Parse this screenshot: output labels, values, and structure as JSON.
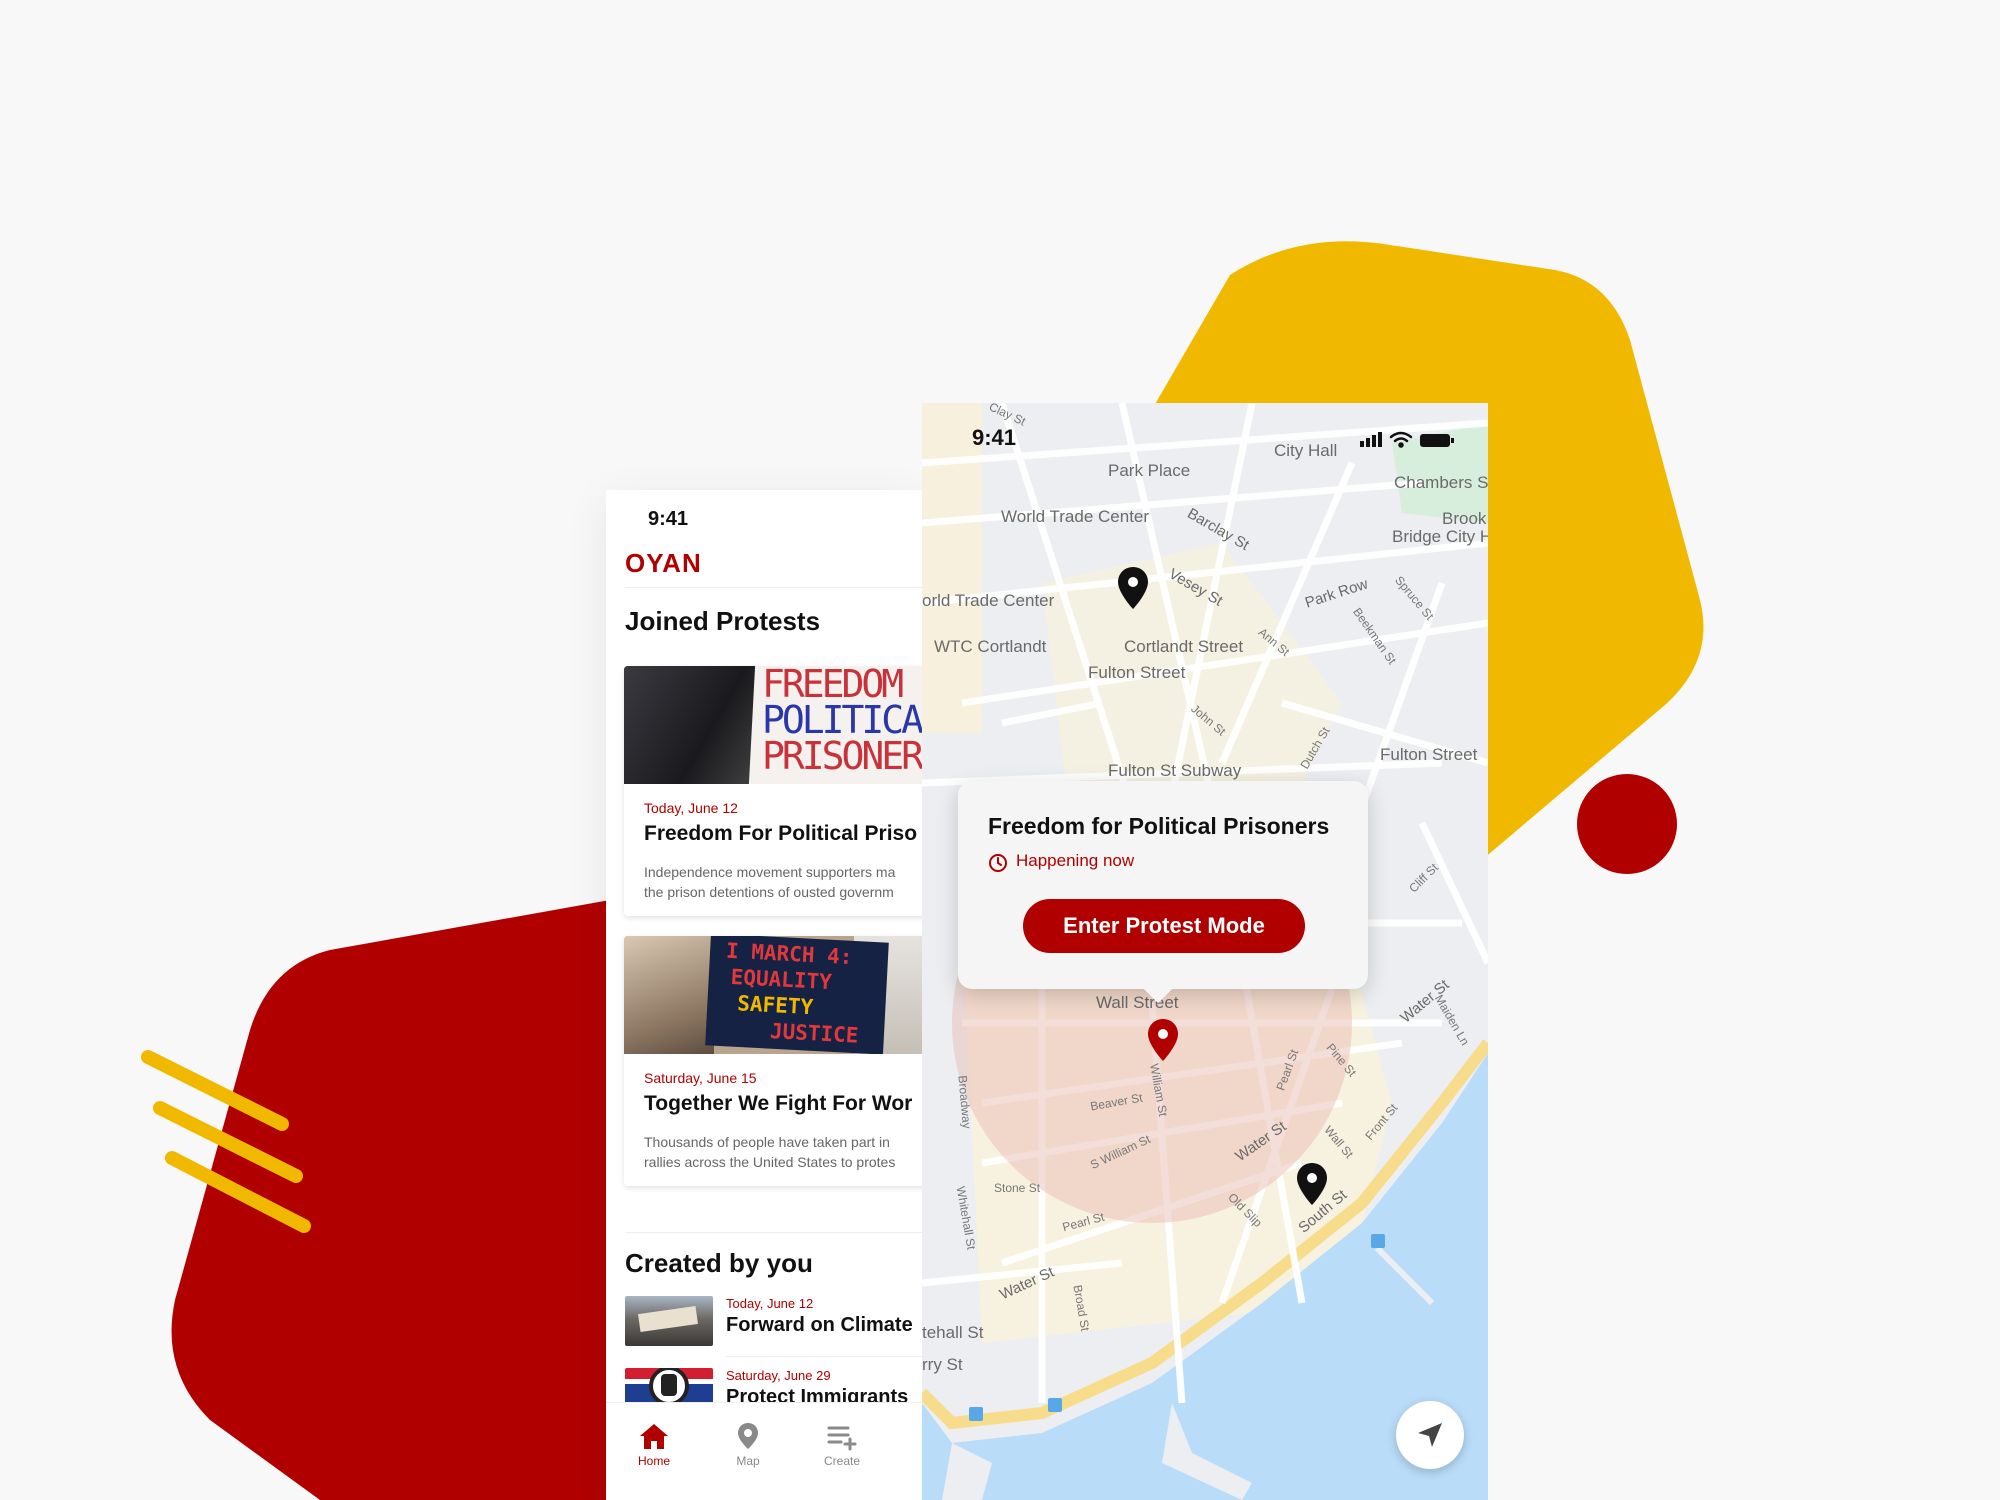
{
  "colors": {
    "accent": "#b10000",
    "yellow": "#f0b900",
    "water": "#b9dcf8"
  },
  "left_phone": {
    "status_time": "9:41",
    "brand": "OYAN",
    "joined_title": "Joined Protests",
    "joined": [
      {
        "image_sign": [
          "FREEDOM F",
          "POLITICAL",
          "PRISONER"
        ],
        "date": "Today, June 12",
        "title": "Freedom For Political Priso",
        "desc1": "Independence movement supporters ma",
        "desc2": "the prison detentions of ousted governm"
      },
      {
        "image_sign": [
          "I MARCH 4:",
          "EQUALITY",
          "SAFETY",
          "JUSTICE"
        ],
        "date": "Saturday, June 15",
        "title": "Together We Fight For Wor",
        "desc1": "Thousands of people have taken part in",
        "desc2": "rallies across the United States to protes"
      }
    ],
    "created_title": "Created by you",
    "created": [
      {
        "date": "Today, June 12",
        "title": "Forward on Climate"
      },
      {
        "date": "Saturday, June 29",
        "title": "Protect Immigrants"
      }
    ],
    "tabs": [
      {
        "label": "Home",
        "icon": "home-icon"
      },
      {
        "label": "Map",
        "icon": "map-pin-icon"
      },
      {
        "label": "Create",
        "icon": "create-list-icon"
      }
    ]
  },
  "right_phone": {
    "status_time": "9:41",
    "map_labels": {
      "city_hall": "City Hall",
      "park_place": "Park Place",
      "chambers": "Chambers S",
      "world_trade_center": "World Trade Center",
      "brook": "Brook",
      "bridge_city": "Bridge City H",
      "barclay": "Barclay St",
      "vesey": "Vesey St",
      "park_row": "Park Row",
      "wtc_partial": "orld Trade Center",
      "wtc_cortlandt": "WTC Cortlandt",
      "cortlandt_street": "Cortlandt Street",
      "fulton_street_1": "Fulton Street",
      "fulton_street_2": "Fulton Street",
      "fulton_subway": "Fulton St Subway",
      "wall_street": "Wall Street",
      "water_st_1": "Water St",
      "water_st_2": "Water St",
      "water_st_3": "Water St",
      "south_st": "South St",
      "tehall": "tehall St",
      "rry": "rry St",
      "beaver": "Beaver St",
      "s_william": "S William St",
      "william": "William St",
      "pearl_1": "Pearl St",
      "pearl_2": "Pearl St",
      "broadway": "Broadway",
      "stone": "Stone St",
      "broad": "Broad St",
      "whitehall": "Whitehall St",
      "ann": "Ann St",
      "john": "John St",
      "dutch": "Dutch St",
      "cliff": "Cliff St",
      "pine": "Pine St",
      "wall": "Wall St",
      "front": "Front St",
      "spruce": "Spruce St",
      "beekman": "Beekman St",
      "clay": "Clay St",
      "old_slip": "Old Slip",
      "maiden": "Maiden Ln"
    },
    "popup": {
      "title": "Freedom for Political Prisoners",
      "status": "Happening now",
      "button": "Enter Protest Mode"
    }
  }
}
